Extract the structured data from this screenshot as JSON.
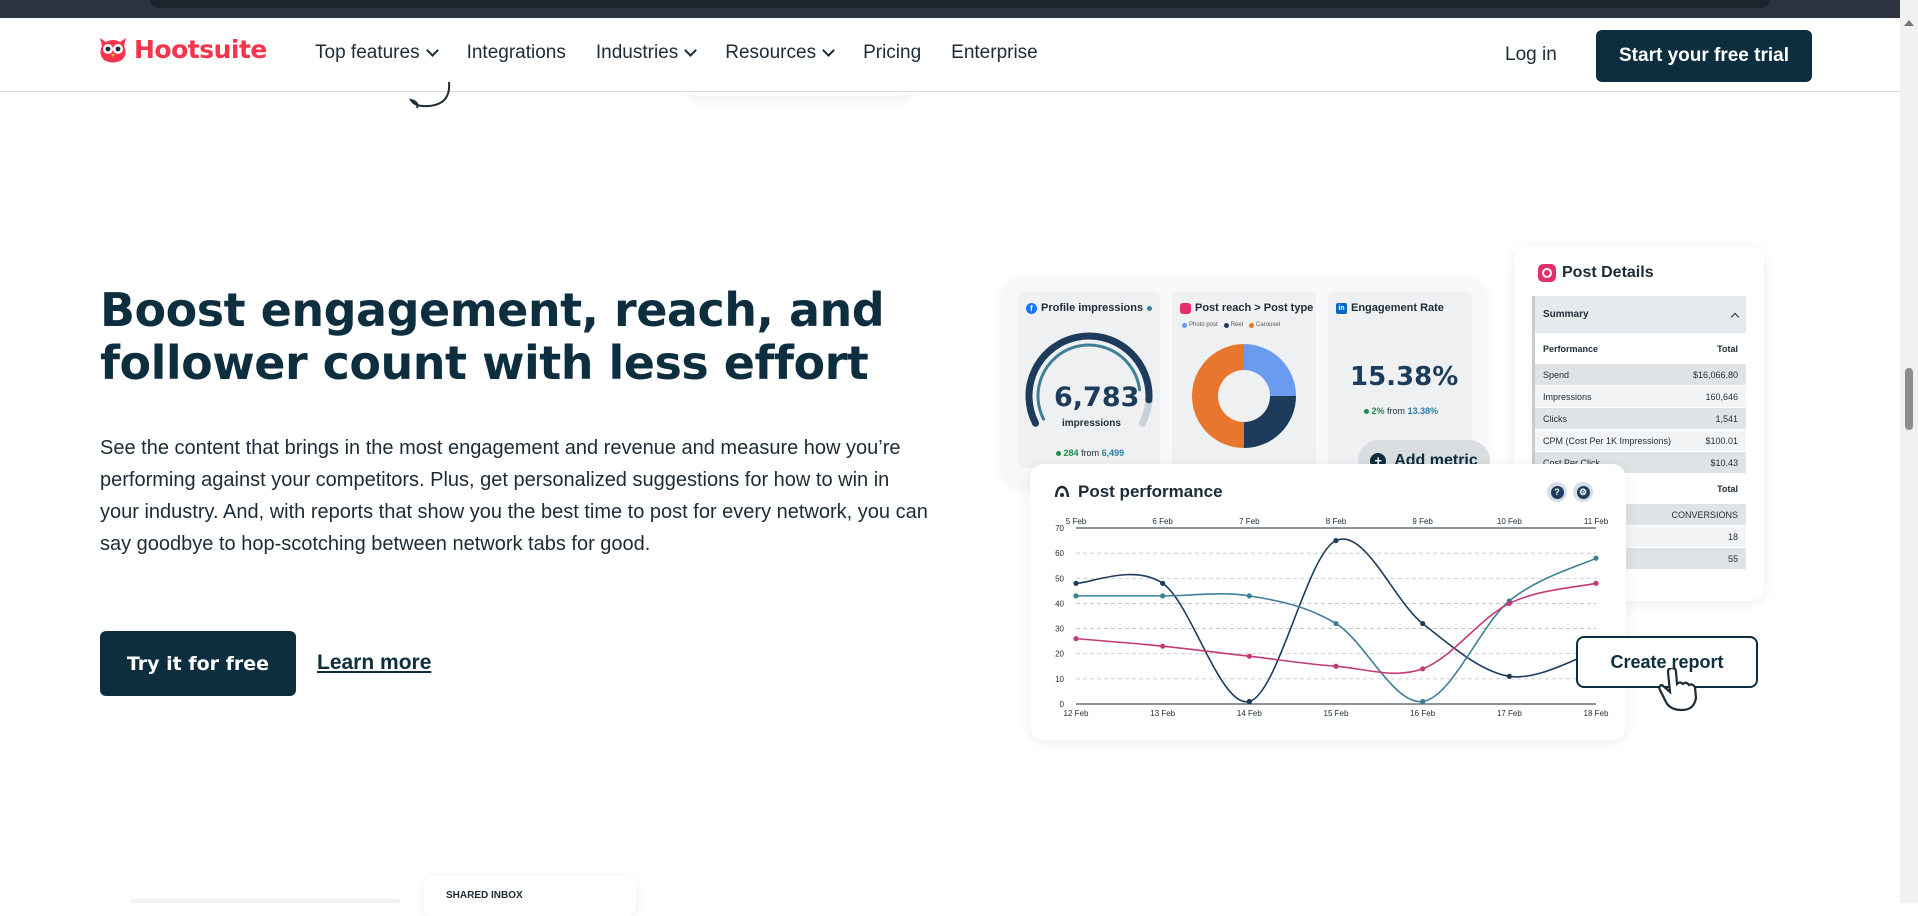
{
  "brand": {
    "name": "Hootsuite",
    "color": "#f4364c",
    "dark": "#0d2e3e"
  },
  "nav": {
    "items": [
      {
        "label": "Top features",
        "dropdown": true
      },
      {
        "label": "Integrations",
        "dropdown": false
      },
      {
        "label": "Industries",
        "dropdown": true
      },
      {
        "label": "Resources",
        "dropdown": true
      },
      {
        "label": "Pricing",
        "dropdown": false
      },
      {
        "label": "Enterprise",
        "dropdown": false
      }
    ],
    "login": "Log in",
    "cta": "Start your free trial"
  },
  "hero": {
    "title": "Boost engagement, reach, and follower count with less effort",
    "description": "See the content that brings in the most engagement and revenue and measure how you’re performing against your competitors. Plus, get personalized suggestions for how to win in your industry. And, with reports that show you the best time to post for every network, you can say goodbye to hop-scotching between network tabs for good.",
    "primary_button": "Try it for free",
    "secondary_link": "Learn more"
  },
  "metrics": {
    "profile_impressions": {
      "title": "Profile impressions",
      "value": "6,783",
      "unit": "impressions",
      "delta": "284",
      "from_label": "from",
      "from_value": "6,499",
      "gauge_fraction": 0.9
    },
    "post_reach": {
      "title": "Post reach > Post type",
      "legend": [
        "Photo post",
        "Reel",
        "Carousel"
      ],
      "colors": [
        "#6b9bef",
        "#1d3b5a",
        "#e8762d"
      ],
      "slices": [
        25,
        25,
        50
      ]
    },
    "engagement_rate": {
      "title": "Engagement Rate",
      "value": "15.38%",
      "delta": "2%",
      "from_label": "from",
      "from_value": "13.38%"
    },
    "add_metric": "Add metric"
  },
  "post_details": {
    "title": "Post Details",
    "summary_label": "Summary",
    "col_metric": "Performance",
    "col_total": "Total",
    "rows": [
      {
        "label": "Spend",
        "value": "$16,066.80"
      },
      {
        "label": "Impressions",
        "value": "160,646"
      },
      {
        "label": "Clicks",
        "value": "1,541"
      },
      {
        "label": "CPM (Cost Per 1K Impressions)",
        "value": "$100.01"
      },
      {
        "label": "Cost Per Click",
        "value": "$10.43"
      }
    ],
    "section2_total": "Total",
    "rows2": [
      {
        "label": "",
        "value": "CONVERSIONS"
      },
      {
        "label": "",
        "value": "18"
      },
      {
        "label": "",
        "value": "55"
      }
    ]
  },
  "post_performance": {
    "title": "Post performance",
    "help_icon": "?",
    "create_report": "Create report"
  },
  "chart_data": {
    "type": "line",
    "title": "Post performance",
    "x_top": [
      "5 Feb",
      "6 Feb",
      "7 Feb",
      "8 Feb",
      "9 Feb",
      "10 Feb",
      "11 Feb"
    ],
    "categories": [
      "12 Feb",
      "13 Feb",
      "14 Feb",
      "15 Feb",
      "16 Feb",
      "17 Feb",
      "18 Feb"
    ],
    "ylim": [
      0,
      70
    ],
    "yticks": [
      0,
      10,
      20,
      30,
      40,
      50,
      60,
      70
    ],
    "grid": true,
    "series": [
      {
        "color": "#1d3b5a",
        "values": [
          48,
          48,
          1,
          65,
          32,
          11,
          21
        ]
      },
      {
        "color": "#3f7f96",
        "values": [
          43,
          43,
          43,
          32,
          1,
          41,
          58
        ]
      },
      {
        "color": "#c43a75",
        "values": [
          26,
          23,
          19,
          15,
          14,
          40,
          48
        ]
      }
    ]
  },
  "shared_inbox": {
    "label": "SHARED INBOX"
  }
}
